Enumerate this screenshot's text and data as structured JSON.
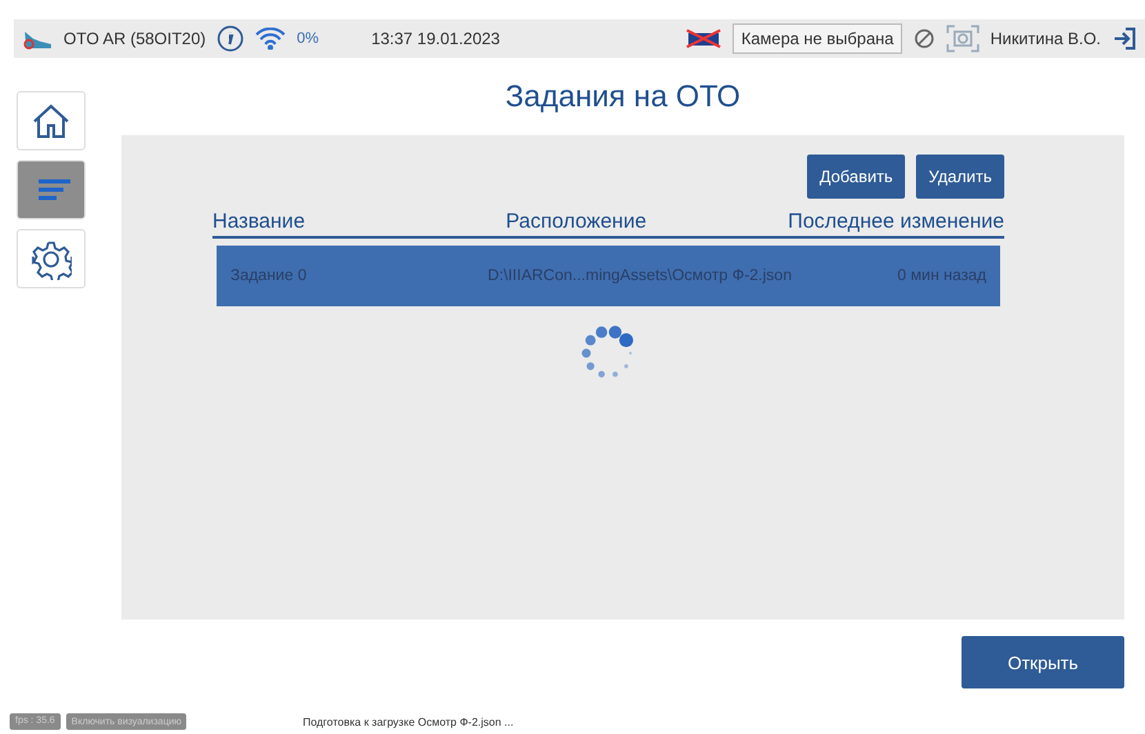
{
  "status_bar": {
    "app_name": "OTO AR (58OIT20)",
    "signal": "0%",
    "datetime": "13:37 19.01.2023",
    "camera": "Камера не выбрана",
    "user": "Никитина В.О."
  },
  "sidebar": {
    "items": [
      {
        "kind": "home",
        "selected": false
      },
      {
        "kind": "tasks",
        "selected": true
      },
      {
        "kind": "settings",
        "selected": false
      }
    ]
  },
  "title": "Задания на ОТО",
  "toolbar": {
    "buttons": [
      "Добавить",
      "Удалить"
    ]
  },
  "table": {
    "columns": [
      "Название",
      "Расположение",
      "Последнее изменение"
    ],
    "rows": [
      {
        "selected": true,
        "cells": [
          "Задание 0",
          "D:\\IIIARCon...mingAssets\\Осмотр Ф-2.json",
          "0 мин назад"
        ]
      }
    ]
  },
  "open_button": "Открыть",
  "footer": {
    "fps": "fps : 35.6",
    "visualize_button": "Включить визуализацию",
    "status": "Подготовка к загрузке Осмотр Ф-2.json ..."
  }
}
